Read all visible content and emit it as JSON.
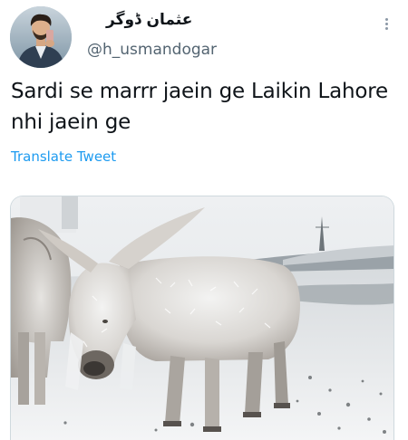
{
  "tweet": {
    "display_name": "عثمان ڈوگر",
    "handle": "@h_usmandogar",
    "text": "Sardi se marrr jaein ge Laikin Lahore nhi jaein ge",
    "translate_label": "Translate Tweet"
  },
  "icons": {
    "more": "more-vertical-icon"
  },
  "colors": {
    "link": "#1d9bf0",
    "secondary_text": "#536471",
    "primary_text": "#0f1419"
  }
}
